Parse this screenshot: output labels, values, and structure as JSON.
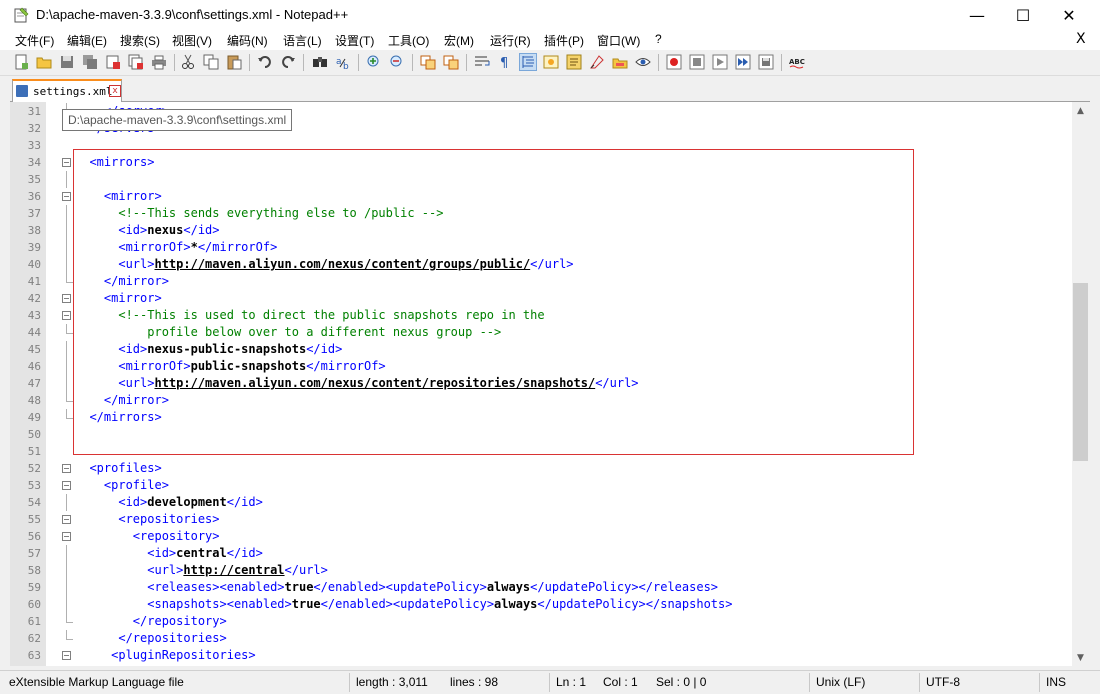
{
  "window": {
    "title": "D:\\apache-maven-3.3.9\\conf\\settings.xml - Notepad++",
    "min_glyph": "—",
    "max_glyph": "☐",
    "close_glyph": "✕"
  },
  "menu": {
    "items": [
      "文件(F)",
      "编辑(E)",
      "搜索(S)",
      "视图(V)",
      "编码(N)",
      "语言(L)",
      "设置(T)",
      "工具(O)",
      "宏(M)",
      "运行(R)",
      "插件(P)",
      "窗口(W)",
      "?"
    ],
    "close_label": "X"
  },
  "toolbar": {
    "icons": [
      "new-file",
      "open-file",
      "save",
      "save-all",
      "close",
      "close-all",
      "print",
      "cut",
      "copy",
      "paste",
      "undo",
      "redo",
      "find",
      "replace",
      "zoom-in",
      "zoom-out",
      "sync-v",
      "sync-h",
      "word-wrap",
      "show-all-chars",
      "indent-guide",
      "doc-map",
      "function-list",
      "folder-workspace",
      "monitoring",
      "record-macro",
      "stop-macro",
      "play-macro",
      "run-macro-multiple",
      "save-macro",
      "spell-check"
    ]
  },
  "tab": {
    "label": "settings.xml",
    "close_glyph": "x"
  },
  "tooltip": "D:\\apache-maven-3.3.9\\conf\\settings.xml",
  "editor": {
    "lines": [
      {
        "n": "31",
        "fold": "line",
        "parts": [
          [
            "tag",
            "    </server>"
          ]
        ]
      },
      {
        "n": "32",
        "fold": "end",
        "parts": [
          [
            "tag",
            "  </servers>"
          ]
        ]
      },
      {
        "n": "33",
        "fold": "",
        "parts": []
      },
      {
        "n": "34",
        "fold": "box",
        "parts": [
          [
            "tag",
            "  <mirrors>"
          ]
        ]
      },
      {
        "n": "35",
        "fold": "line",
        "parts": []
      },
      {
        "n": "36",
        "fold": "box",
        "parts": [
          [
            "tag",
            "    <mirror>"
          ]
        ]
      },
      {
        "n": "37",
        "fold": "line",
        "parts": [
          [
            "cmt",
            "      <!--This sends everything else to /public -->"
          ]
        ]
      },
      {
        "n": "38",
        "fold": "line",
        "parts": [
          [
            "tag",
            "      <id>"
          ],
          [
            "txt",
            "nexus"
          ],
          [
            "tag",
            "</id>"
          ]
        ]
      },
      {
        "n": "39",
        "fold": "line",
        "parts": [
          [
            "tag",
            "      <mirrorOf>"
          ],
          [
            "txt",
            "*"
          ],
          [
            "tag",
            "</mirrorOf>"
          ]
        ]
      },
      {
        "n": "40",
        "fold": "line",
        "parts": [
          [
            "tag",
            "      <url>"
          ],
          [
            "url",
            "http://maven.aliyun.com/nexus/content/groups/public/"
          ],
          [
            "tag",
            "</url>"
          ]
        ]
      },
      {
        "n": "41",
        "fold": "end",
        "parts": [
          [
            "tag",
            "    </mirror>"
          ]
        ]
      },
      {
        "n": "42",
        "fold": "box",
        "parts": [
          [
            "tag",
            "    <mirror>"
          ]
        ]
      },
      {
        "n": "43",
        "fold": "box",
        "parts": [
          [
            "cmt",
            "      <!--This is used to direct the public snapshots repo in the"
          ]
        ]
      },
      {
        "n": "44",
        "fold": "end",
        "parts": [
          [
            "cmt",
            "          profile below over to a different nexus group -->"
          ]
        ]
      },
      {
        "n": "45",
        "fold": "line",
        "parts": [
          [
            "tag",
            "      <id>"
          ],
          [
            "txt",
            "nexus-public-snapshots"
          ],
          [
            "tag",
            "</id>"
          ]
        ]
      },
      {
        "n": "46",
        "fold": "line",
        "parts": [
          [
            "tag",
            "      <mirrorOf>"
          ],
          [
            "txt",
            "public-snapshots"
          ],
          [
            "tag",
            "</mirrorOf>"
          ]
        ]
      },
      {
        "n": "47",
        "fold": "line",
        "parts": [
          [
            "tag",
            "      <url>"
          ],
          [
            "url",
            "http://maven.aliyun.com/nexus/content/repositories/snapshots/"
          ],
          [
            "tag",
            "</url>"
          ]
        ]
      },
      {
        "n": "48",
        "fold": "end",
        "parts": [
          [
            "tag",
            "    </mirror>"
          ]
        ]
      },
      {
        "n": "49",
        "fold": "end",
        "parts": [
          [
            "tag",
            "  </mirrors>"
          ]
        ]
      },
      {
        "n": "50",
        "fold": "",
        "parts": []
      },
      {
        "n": "51",
        "fold": "",
        "parts": []
      },
      {
        "n": "52",
        "fold": "box",
        "parts": [
          [
            "tag",
            "  <profiles>"
          ]
        ]
      },
      {
        "n": "53",
        "fold": "box",
        "parts": [
          [
            "tag",
            "    <profile>"
          ]
        ]
      },
      {
        "n": "54",
        "fold": "line",
        "parts": [
          [
            "tag",
            "      <id>"
          ],
          [
            "txt",
            "development"
          ],
          [
            "tag",
            "</id>"
          ]
        ]
      },
      {
        "n": "55",
        "fold": "box",
        "parts": [
          [
            "tag",
            "      <repositories>"
          ]
        ]
      },
      {
        "n": "56",
        "fold": "box",
        "parts": [
          [
            "tag",
            "        <repository>"
          ]
        ]
      },
      {
        "n": "57",
        "fold": "line",
        "parts": [
          [
            "tag",
            "          <id>"
          ],
          [
            "txt",
            "central"
          ],
          [
            "tag",
            "</id>"
          ]
        ]
      },
      {
        "n": "58",
        "fold": "line",
        "parts": [
          [
            "tag",
            "          <url>"
          ],
          [
            "url",
            "http://central"
          ],
          [
            "tag",
            "</url>"
          ]
        ]
      },
      {
        "n": "59",
        "fold": "line",
        "parts": [
          [
            "tag",
            "          <releases><enabled>"
          ],
          [
            "txt",
            "true"
          ],
          [
            "tag",
            "</enabled><updatePolicy>"
          ],
          [
            "txt",
            "always"
          ],
          [
            "tag",
            "</updatePolicy></releases>"
          ]
        ]
      },
      {
        "n": "60",
        "fold": "line",
        "parts": [
          [
            "tag",
            "          <snapshots><enabled>"
          ],
          [
            "txt",
            "true"
          ],
          [
            "tag",
            "</enabled><updatePolicy>"
          ],
          [
            "txt",
            "always"
          ],
          [
            "tag",
            "</updatePolicy></snapshots>"
          ]
        ]
      },
      {
        "n": "61",
        "fold": "end",
        "parts": [
          [
            "tag",
            "        </repository>"
          ]
        ]
      },
      {
        "n": "62",
        "fold": "end",
        "parts": [
          [
            "tag",
            "      </repositories>"
          ]
        ]
      },
      {
        "n": "63",
        "fold": "box",
        "parts": [
          [
            "tag",
            "     <pluginRepositories>"
          ]
        ]
      }
    ]
  },
  "status": {
    "language": "eXtensible Markup Language file",
    "length": "length : 3,011",
    "lines": "lines : 98",
    "ln": "Ln : 1",
    "col": "Col : 1",
    "sel": "Sel : 0 | 0",
    "eol": "Unix (LF)",
    "encoding": "UTF-8",
    "mode": "INS"
  },
  "colors": {
    "tag": "#0000ff",
    "comment": "#008000",
    "highlight_box": "#d93333",
    "tab_accent": "#fa8d1c"
  }
}
